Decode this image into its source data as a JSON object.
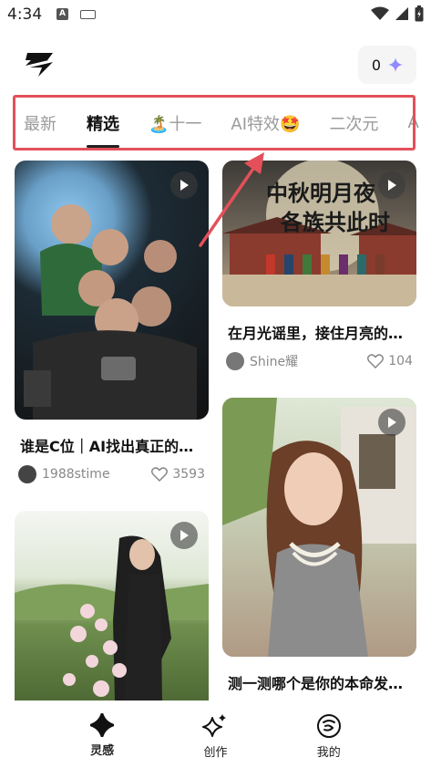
{
  "status_bar": {
    "time": "4:34",
    "notif_letter": "A"
  },
  "header": {
    "credit_count": "0"
  },
  "tabs": [
    {
      "label": "最新"
    },
    {
      "label": "精选"
    },
    {
      "label": "🏝️十一"
    },
    {
      "label": "AI特效🤩"
    },
    {
      "label": "二次元"
    },
    {
      "label": "A"
    }
  ],
  "active_tab": "精选",
  "feed": {
    "left": [
      {
        "title": "谁是C位｜AI找出真正的…",
        "author": "1988stime",
        "likes": "3593"
      },
      {
        "title": "",
        "author": "",
        "likes": ""
      }
    ],
    "right": [
      {
        "title": "在月光谣里，接住月亮的…",
        "author": "Shine耀",
        "likes": "104",
        "overlay_line1": "中秋明月夜",
        "overlay_line2": "各族共此时"
      },
      {
        "title": "测一测哪个是你的本命发…",
        "author": "",
        "likes": ""
      }
    ]
  },
  "bottom_nav": [
    {
      "label": "灵感",
      "icon": "inspiration-icon"
    },
    {
      "label": "创作",
      "icon": "sparkle-icon"
    },
    {
      "label": "我的",
      "icon": "profile-icon"
    }
  ],
  "colors": {
    "highlight_border": "#e4505a",
    "accent": "#8a6cff"
  }
}
